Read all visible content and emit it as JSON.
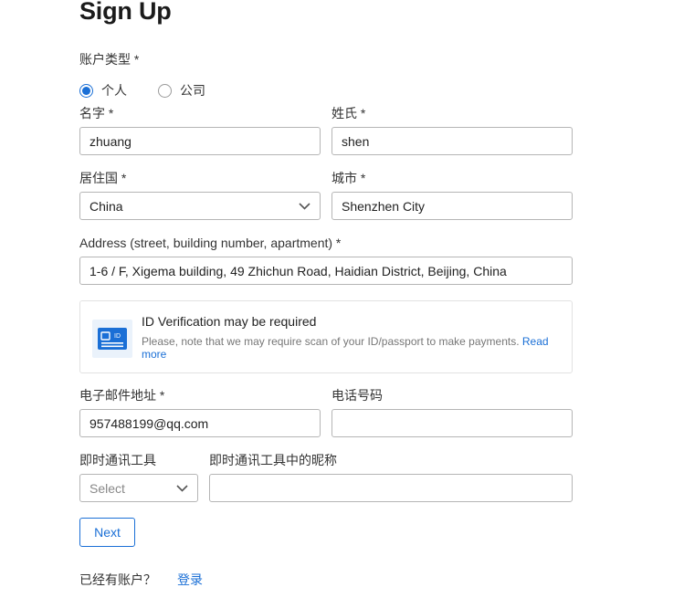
{
  "form": {
    "title": "Sign Up",
    "account_type": {
      "label": "账户类型 *",
      "options": [
        {
          "label": "个人",
          "checked": true
        },
        {
          "label": "公司",
          "checked": false
        }
      ]
    },
    "first_name": {
      "label": "名字 *",
      "value": "zhuang"
    },
    "last_name": {
      "label": "姓氏 *",
      "value": "shen"
    },
    "country": {
      "label": "居住国 *",
      "value": "China"
    },
    "city": {
      "label": "城市 *",
      "value": "Shenzhen City"
    },
    "address": {
      "label": "Address (street, building number, apartment) *",
      "value": "1-6 / F, Xigema building, 49 Zhichun Road, Haidian District, Beijing, China"
    },
    "id_notice": {
      "title": "ID Verification may be required",
      "text": "Please, note that we may require scan of your ID/passport to make payments.",
      "link": "Read more",
      "icon": "id-card-icon"
    },
    "email": {
      "label": "电子邮件地址 *",
      "value": "957488199@qq.com"
    },
    "phone": {
      "label": "电话号码",
      "value": ""
    },
    "messenger": {
      "label": "即时通讯工具",
      "placeholder": "Select"
    },
    "messenger_nickname": {
      "label": "即时通讯工具中的昵称",
      "value": ""
    },
    "next_label": "Next",
    "have_account": "已经有账户？",
    "login_label": "登录"
  },
  "colors": {
    "accent": "#1a6fd6",
    "border": "#b5b5b5",
    "icon_bg": "#eaf2fb"
  }
}
